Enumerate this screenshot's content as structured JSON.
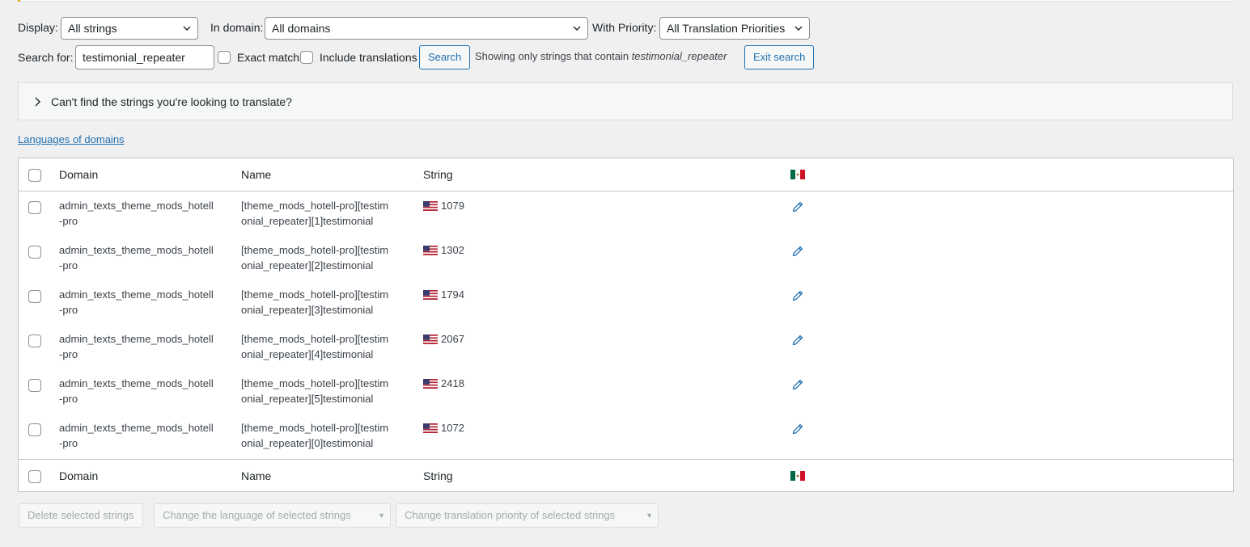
{
  "filters": {
    "display_label": "Display:",
    "display_value": "All strings",
    "domain_label": "In domain:",
    "domain_value": "All domains",
    "priority_label": "With Priority:",
    "priority_value": "All Translation Priorities"
  },
  "search": {
    "label": "Search for:",
    "value": "testimonial_repeater",
    "exact_match_label": "Exact match",
    "include_translations_label": "Include translations",
    "search_button": "Search",
    "showing_text": "Showing only strings that contain",
    "showing_term": "testimonial_repeater",
    "exit_button": "Exit search"
  },
  "accordion": {
    "text": "Can't find the strings you're looking to translate?"
  },
  "languages_link": "Languages of domains",
  "table": {
    "columns": {
      "domain": "Domain",
      "name": "Name",
      "string": "String"
    },
    "rows": [
      {
        "domain": "admin_texts_theme_mods_hotell-pro",
        "domain_l1": "admin_texts_theme_mods_hotell",
        "domain_l2": "-pro",
        "name_l1": "[theme_mods_hotell-pro][testim",
        "name_l2": "onial_repeater][1]testimonial",
        "string": "1079"
      },
      {
        "domain": "admin_texts_theme_mods_hotell-pro",
        "domain_l1": "admin_texts_theme_mods_hotell",
        "domain_l2": "-pro",
        "name_l1": "[theme_mods_hotell-pro][testim",
        "name_l2": "onial_repeater][2]testimonial",
        "string": "1302"
      },
      {
        "domain": "admin_texts_theme_mods_hotell-pro",
        "domain_l1": "admin_texts_theme_mods_hotell",
        "domain_l2": "-pro",
        "name_l1": "[theme_mods_hotell-pro][testim",
        "name_l2": "onial_repeater][3]testimonial",
        "string": "1794"
      },
      {
        "domain": "admin_texts_theme_mods_hotell-pro",
        "domain_l1": "admin_texts_theme_mods_hotell",
        "domain_l2": "-pro",
        "name_l1": "[theme_mods_hotell-pro][testim",
        "name_l2": "onial_repeater][4]testimonial",
        "string": "2067"
      },
      {
        "domain": "admin_texts_theme_mods_hotell-pro",
        "domain_l1": "admin_texts_theme_mods_hotell",
        "domain_l2": "-pro",
        "name_l1": "[theme_mods_hotell-pro][testim",
        "name_l2": "onial_repeater][5]testimonial",
        "string": "2418"
      },
      {
        "domain": "admin_texts_theme_mods_hotell-pro",
        "domain_l1": "admin_texts_theme_mods_hotell",
        "domain_l2": "-pro",
        "name_l1": "[theme_mods_hotell-pro][testim",
        "name_l2": "onial_repeater][0]testimonial",
        "string": "1072"
      }
    ]
  },
  "bulk_actions": {
    "delete": "Delete selected strings",
    "change_language": "Change the language of selected strings",
    "change_priority": "Change translation priority of selected strings"
  },
  "icons": {
    "source_flag": "us-flag-icon",
    "target_flag": "mexico-flag-icon",
    "edit": "pencil-icon"
  },
  "colors": {
    "accent": "#2271b1",
    "border": "#c3c4c7",
    "background": "#f0f0f1"
  }
}
